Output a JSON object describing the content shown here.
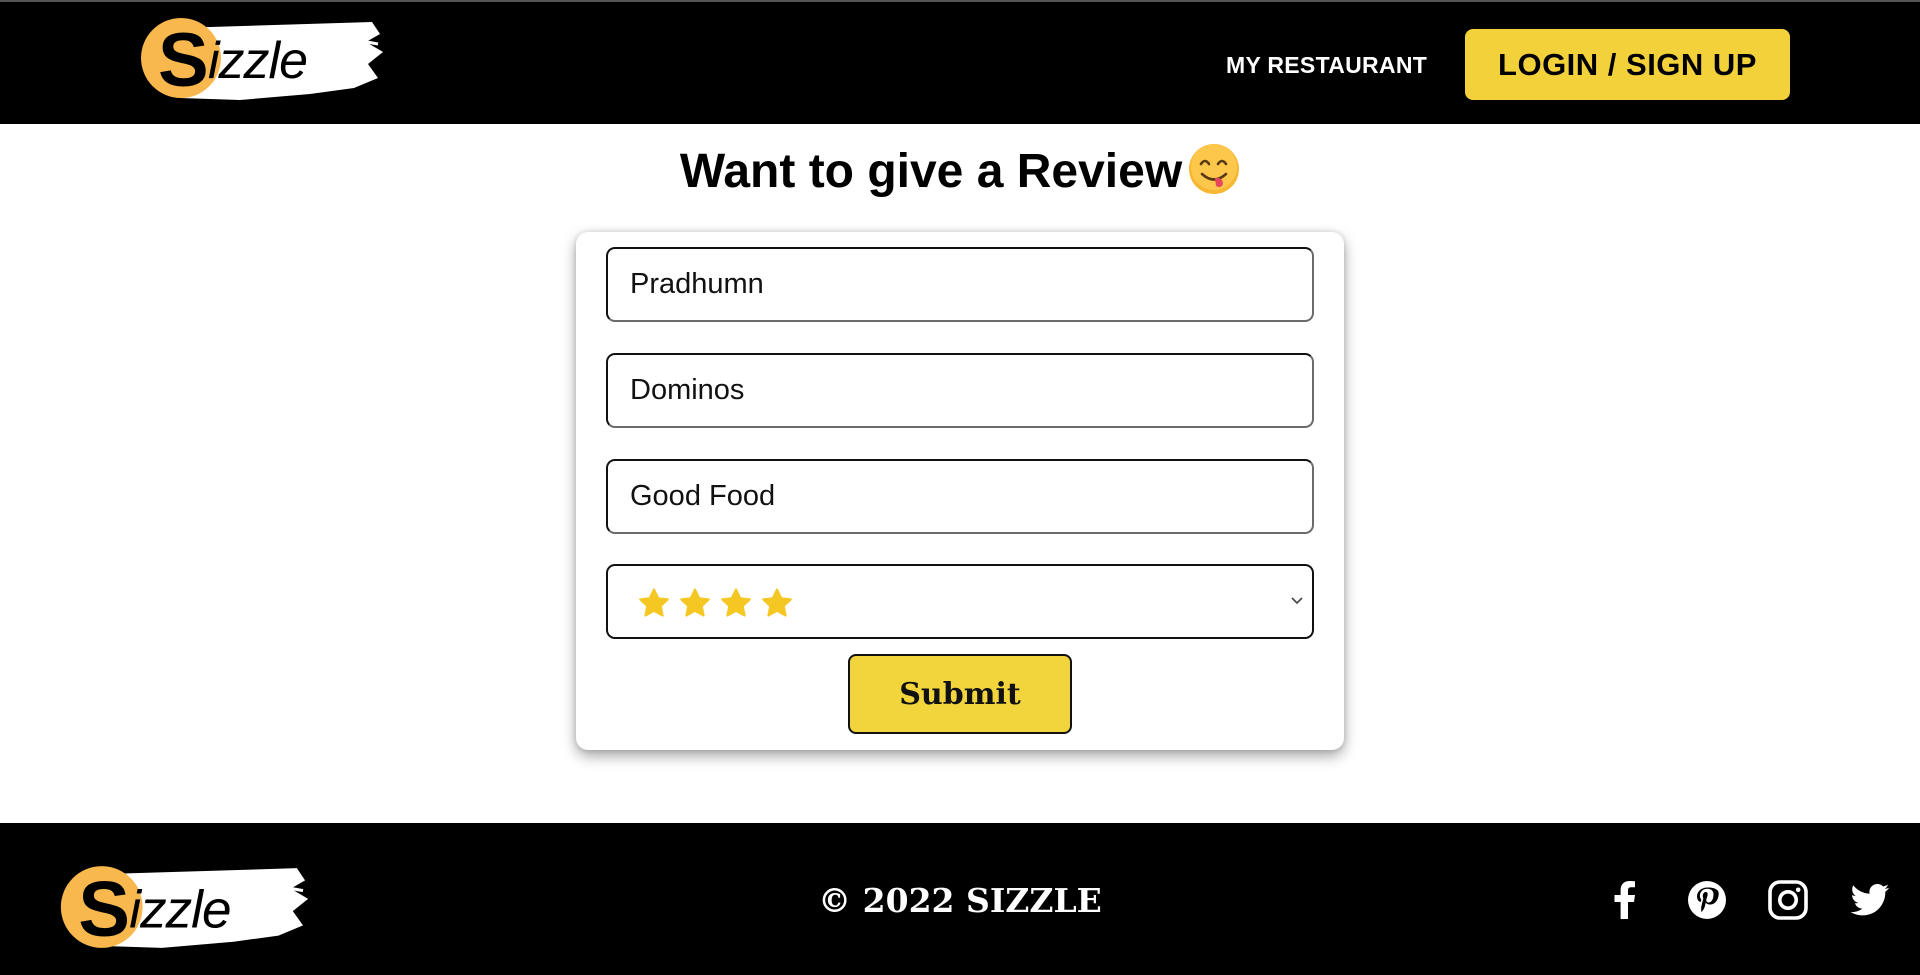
{
  "brand": {
    "logo_text": "Sizzle",
    "logo_icon": "sizzle-logo",
    "colors": {
      "accent": "#f2d13a",
      "header_bg": "#000000",
      "logo_circle": "#f8b84e"
    }
  },
  "nav": {
    "my_restaurant": "MY RESTAURANT",
    "login_signup": "LOGIN / SIGN UP"
  },
  "page": {
    "title": "Want to give a Review",
    "title_emoji": "face-savoring-food-emoji"
  },
  "form": {
    "name_value": "Pradhumn",
    "restaurant_value": "Dominos",
    "review_value": "Good Food",
    "rating": {
      "selected_stars": 4,
      "icon": "star-icon",
      "star_color": "#f5c723"
    },
    "submit_label": "Submit"
  },
  "footer": {
    "copyright": "© 2022 SIZZLE",
    "social_icons": [
      "facebook-icon",
      "pinterest-icon",
      "instagram-icon",
      "twitter-icon"
    ]
  }
}
